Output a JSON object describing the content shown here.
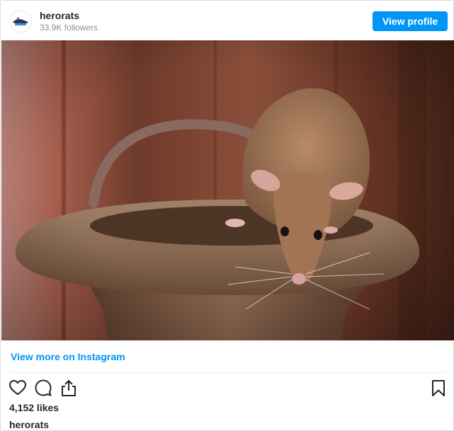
{
  "post": {
    "username": "herorats",
    "followers": "33.9K followers",
    "view_profile_label": "View profile",
    "image_alt": "African giant pouched rat perched on the rim of a terracotta pot",
    "view_more_label": "View more on Instagram",
    "likes": "4,152 likes",
    "caption_username": "herorats"
  },
  "icons": [
    "heart-icon",
    "comment-icon",
    "share-icon",
    "bookmark-icon"
  ],
  "colors": {
    "accent": "#0095f6",
    "text": "#262626",
    "muted": "#8e8e8e",
    "border": "#dbdbdb"
  }
}
